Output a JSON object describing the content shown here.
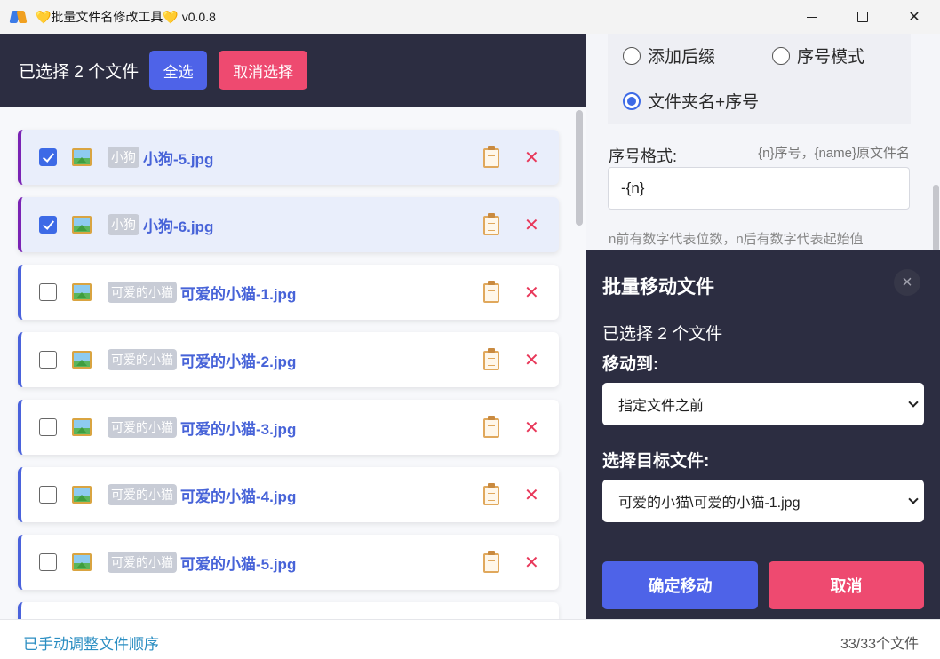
{
  "window": {
    "title": "💛批量文件名修改工具💛 v0.0.8",
    "min_icon": "minimize-icon",
    "max_icon": "maximize-icon",
    "close_label": "✕"
  },
  "left": {
    "selected_text": "已选择 2 个文件",
    "select_all": "全选",
    "cancel_select": "取消选择",
    "files": [
      {
        "checked": true,
        "tag": "小狗",
        "name": "小狗-5.jpg"
      },
      {
        "checked": true,
        "tag": "小狗",
        "name": "小狗-6.jpg"
      },
      {
        "checked": false,
        "tag": "可爱的小猫",
        "name": "可爱的小猫-1.jpg"
      },
      {
        "checked": false,
        "tag": "可爱的小猫",
        "name": "可爱的小猫-2.jpg"
      },
      {
        "checked": false,
        "tag": "可爱的小猫",
        "name": "可爱的小猫-3.jpg"
      },
      {
        "checked": false,
        "tag": "可爱的小猫",
        "name": "可爱的小猫-4.jpg"
      },
      {
        "checked": false,
        "tag": "可爱的小猫",
        "name": "可爱的小猫-5.jpg"
      }
    ],
    "delete_label": "✕"
  },
  "right": {
    "modes": {
      "suffix": "添加后缀",
      "sequence": "序号模式",
      "folder_seq": "文件夹名+序号"
    },
    "format_label": "序号格式:",
    "format_hint": "{n}序号，{name}原文件名",
    "format_value": "-{n}",
    "format_note": "n前有数字代表位数，n后有数字代表起始值"
  },
  "dialog": {
    "title": "批量移动文件",
    "close_label": "×",
    "selected_text": "已选择 2 个文件",
    "move_to_label": "移动到:",
    "move_to_value": "指定文件之前",
    "target_label": "选择目标文件:",
    "target_value": "可爱的小猫\\可爱的小猫-1.jpg",
    "confirm": "确定移动",
    "cancel": "取消"
  },
  "footer": {
    "status": "已手动调整文件顺序",
    "count": "33/33个文件"
  },
  "colors": {
    "accent_blue": "#4e63e8",
    "accent_pink": "#ee4a70",
    "dark_panel": "#2c2d41",
    "file_name": "#4763d8"
  }
}
